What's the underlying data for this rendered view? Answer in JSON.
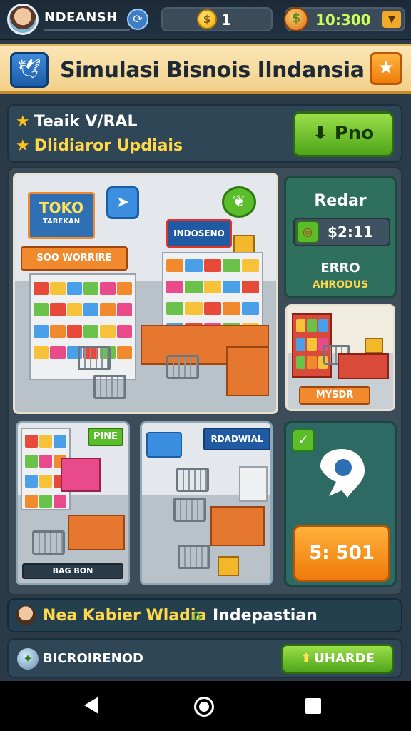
{
  "status": {
    "player_name": "NDEANSH",
    "coins": "1",
    "cash": "10:300",
    "level_icon": "speed-icon",
    "coin_icon_glyph": "$"
  },
  "title": {
    "text": "Simulasi Bisnois Ilndansia",
    "logo_icon": "bird-logo-icon",
    "star_icon": "star-icon"
  },
  "task": {
    "line1": "Teaik V/RAL",
    "line2": "Dlidiaror Updiais",
    "play_label": "Pno"
  },
  "scene": {
    "sign_toko": "TOKO",
    "sign_toko_sub": "TAREKAN",
    "sign_side": "SOO WORRIRE",
    "sign_main": "INDOSENO",
    "side_tag": "MYSDR",
    "tag_pine": "PINE",
    "tag_bottom": "BAG BON",
    "tag_radio": "RDADWIAL"
  },
  "radar": {
    "title": "Redar",
    "price": "$2:11",
    "label1": "ERRO",
    "label2": "AHRODUS"
  },
  "map_card": {
    "value": "5: 501"
  },
  "news": {
    "text_a": "Nea Kabier Wladia",
    "text_b": "Indepastian"
  },
  "upgrade": {
    "label": "BICROIRENOD",
    "button": "UHARDE"
  },
  "colors": {
    "accent_green": "#5bbd2a",
    "accent_orange": "#ee7a0a",
    "title_bg": "#f2d08a",
    "panel_bg": "#2f4657"
  }
}
